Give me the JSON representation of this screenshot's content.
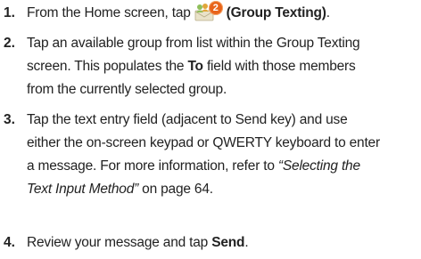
{
  "steps": [
    {
      "number": "1.",
      "before": "From the Home screen, tap",
      "icon_badge": "2",
      "bold": "(Group Texting)",
      "after": "."
    },
    {
      "number": "2.",
      "line1": "Tap an available group from list within the Group Texting",
      "line2_pre": "screen. This populates the",
      "line2_bold": "To",
      "line2_post": "field with those members",
      "line3": "from the currently selected group."
    },
    {
      "number": "3.",
      "line1": "Tap the text entry field (adjacent to Send key) and use",
      "line2": "either the on-screen keypad or QWERTY keyboard to enter",
      "line3_pre": "a message. For more information, refer to",
      "line3_italic": "“Selecting the",
      "line4_italic": "Text Input Method”",
      "line4_post": " on page 64."
    },
    {
      "number": "4.",
      "pre": "Review your message and tap",
      "bold": "Send",
      "post": "."
    }
  ]
}
